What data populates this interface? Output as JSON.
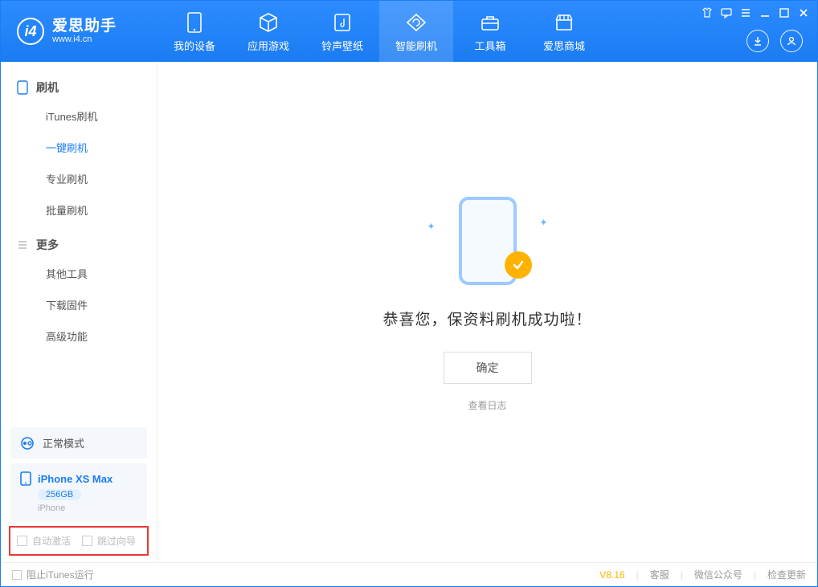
{
  "app": {
    "name": "爱思助手",
    "url": "www.i4.cn"
  },
  "nav": {
    "items": [
      {
        "label": "我的设备",
        "icon": "device"
      },
      {
        "label": "应用游戏",
        "icon": "cube"
      },
      {
        "label": "铃声壁纸",
        "icon": "music"
      },
      {
        "label": "智能刷机",
        "icon": "refresh",
        "active": true
      },
      {
        "label": "工具箱",
        "icon": "toolbox"
      },
      {
        "label": "爱思商城",
        "icon": "store"
      }
    ]
  },
  "sidebar": {
    "section1": {
      "title": "刷机"
    },
    "items1": [
      {
        "label": "iTunes刷机"
      },
      {
        "label": "一键刷机",
        "active": true
      },
      {
        "label": "专业刷机"
      },
      {
        "label": "批量刷机"
      }
    ],
    "section2": {
      "title": "更多"
    },
    "items2": [
      {
        "label": "其他工具"
      },
      {
        "label": "下载固件"
      },
      {
        "label": "高级功能"
      }
    ],
    "mode": {
      "label": "正常模式"
    },
    "device": {
      "name": "iPhone XS Max",
      "capacity": "256GB",
      "type": "iPhone"
    },
    "checkboxes": {
      "auto_activate": "自动激活",
      "skip_guide": "跳过向导"
    }
  },
  "main": {
    "success": "恭喜您，保资料刷机成功啦！",
    "ok": "确定",
    "view_log": "查看日志"
  },
  "footer": {
    "block_itunes": "阻止iTunes运行",
    "version": "V8.16",
    "support": "客服",
    "wechat": "微信公众号",
    "check_update": "检查更新"
  }
}
